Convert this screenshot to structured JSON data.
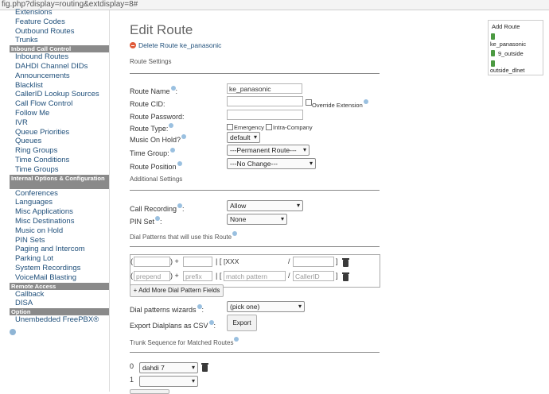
{
  "url": "fig.php?display=routing&extdisplay=8#",
  "sidebar": {
    "group1": [
      "Extensions",
      "Feature Codes",
      "Outbound Routes",
      "Trunks"
    ],
    "header_inbound": "Inbound Call Control",
    "group2": [
      "Inbound Routes",
      "DAHDI Channel DIDs",
      "Announcements",
      "Blacklist",
      "CallerID Lookup Sources",
      "Call Flow Control",
      "Follow Me",
      "IVR",
      "Queue Priorities",
      "Queues",
      "Ring Groups",
      "Time Conditions",
      "Time Groups"
    ],
    "header_internal": "Internal Options & Configuration",
    "group3": [
      "Conferences",
      "Languages",
      "Misc Applications",
      "Misc Destinations",
      "Music on Hold",
      "PIN Sets",
      "Paging and Intercom",
      "Parking Lot",
      "System Recordings",
      "VoiceMail Blasting"
    ],
    "header_remote": "Remote Access",
    "group4": [
      "Callback",
      "DISA"
    ],
    "header_option": "Option",
    "group5": [
      "Unembedded FreePBX®"
    ]
  },
  "page": {
    "title": "Edit Route",
    "delete_link": "Delete Route ke_panasonic",
    "route_settings": "Route Settings",
    "route_name_label": "Route Name",
    "route_name_value": "ke_panasonic",
    "route_cid_label": "Route CID:",
    "override_extension": "Override Extension",
    "route_password_label": "Route Password:",
    "route_type_label": "Route Type:",
    "emergency": "Emergency",
    "intra_company": "Intra-Company",
    "music_on_hold_label": "Music On Hold?",
    "music_on_hold_value": "default",
    "time_group_label": "Time Group:",
    "time_group_value": "---Permanent Route---",
    "route_position_label": "Route Position",
    "route_position_value": "---No Change---",
    "additional_settings": "Additional Settings",
    "call_recording_label": "Call Recording",
    "call_recording_value": "Allow",
    "pin_set_label": "PIN Set",
    "pin_set_value": "None",
    "dial_patterns_title": "Dial Patterns that will use this Route",
    "dp_row1_match": "[XXX",
    "dp_prepend_ph": "prepend",
    "dp_prefix_ph": "prefix",
    "dp_match_ph": "match pattern",
    "dp_callerid_ph": "CallerID",
    "add_more_button": "+ Add More Dial Pattern Fields",
    "dial_wizard_label": "Dial patterns wizards",
    "dial_wizard_value": "(pick one)",
    "export_label": "Export Dialplans as CSV",
    "export_button": "Export",
    "trunk_seq_title": "Trunk Sequence for Matched Routes",
    "trunk_0_num": "0",
    "trunk_0_value": "dahdi 7",
    "trunk_1_num": "1",
    "trunk_1_value": ""
  },
  "rightbox": {
    "title": "Add Route",
    "items": [
      "ke_panasonic",
      "9_outside",
      "outside_dlnet"
    ]
  }
}
